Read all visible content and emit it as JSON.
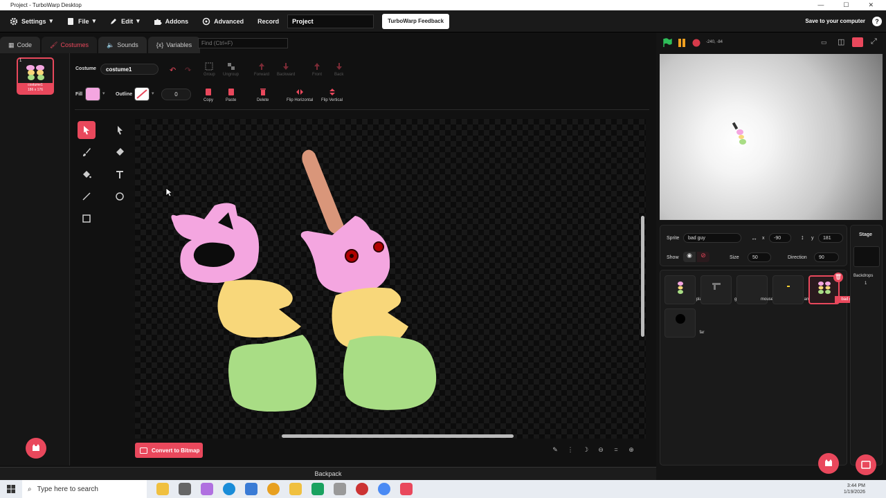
{
  "window": {
    "title": "Project - TurboWarp Desktop"
  },
  "menu": {
    "settings": "Settings",
    "file": "File",
    "edit": "Edit",
    "addons": "Addons",
    "advanced": "Advanced",
    "record": "Record",
    "project_name": "Project",
    "feedback": "TurboWarp Feedback",
    "save": "Save to your computer"
  },
  "tabs": {
    "code": "Code",
    "costumes": "Costumes",
    "sounds": "Sounds",
    "variables": "Variables"
  },
  "find": {
    "placeholder": "Find (Ctrl+F)"
  },
  "costume_list": [
    {
      "index": "1",
      "name": "costume1",
      "size": "186 x 176"
    }
  ],
  "editor": {
    "costume_label": "Costume",
    "costume_name": "costume1",
    "fill_label": "Fill",
    "outline_label": "Outline",
    "outline_width": "0",
    "fill_color": "#f4a6e0",
    "group": "Group",
    "ungroup": "Ungroup",
    "forward": "Forward",
    "backward": "Backward",
    "front": "Front",
    "back": "Back",
    "copy": "Copy",
    "paste": "Paste",
    "delete": "Delete",
    "flip_h": "Flip Horizontal",
    "flip_v": "Flip Vertical",
    "convert": "Convert to Bitmap"
  },
  "backpack": "Backpack",
  "stage": {
    "coords": "-240, -84"
  },
  "sprite_info": {
    "sprite_label": "Sprite",
    "sprite_name": "bad guy",
    "x_label": "x",
    "x": "-90",
    "y_label": "y",
    "y": "181",
    "show_label": "Show",
    "size_label": "Size",
    "size": "50",
    "direction_label": "Direction",
    "direction": "90"
  },
  "sprites": [
    {
      "name": "player"
    },
    {
      "name": "gun"
    },
    {
      "name": "mouse"
    },
    {
      "name": "ammo"
    },
    {
      "name": "bad guy"
    },
    {
      "name": "far"
    }
  ],
  "stage_panel": {
    "label": "Stage",
    "backdrops_label": "Backdrops",
    "backdrops_count": "1"
  },
  "taskbar": {
    "search": "Type here to search",
    "time": "3:44 PM",
    "date": "1/19/2026"
  },
  "colors": {
    "accent": "#e9485c",
    "pink": "#f4a6e0",
    "yellow": "#f8d77a",
    "green": "#a9dd85",
    "stick": "#d9967a"
  }
}
